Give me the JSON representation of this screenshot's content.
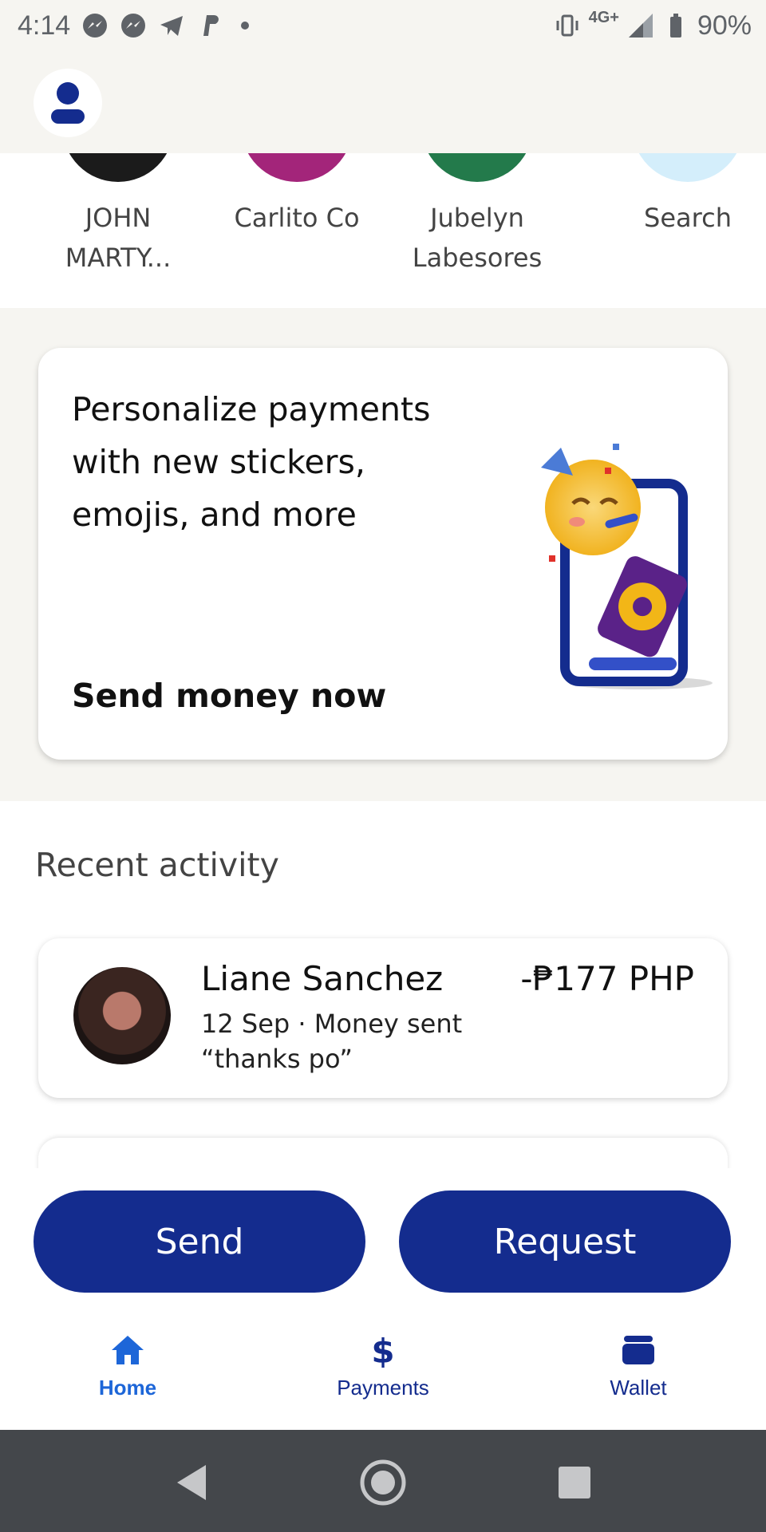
{
  "status_bar": {
    "time": "4:14",
    "network": "4G+",
    "battery": "90%",
    "notification_icons": [
      "messenger-icon",
      "messenger-icon",
      "telegram-icon",
      "paypal-icon"
    ]
  },
  "contacts": [
    {
      "name": "JOHN MARTY...",
      "color": "#1b1b1b"
    },
    {
      "name": "Carlito Co",
      "color": "#a3257a"
    },
    {
      "name": "Jubelyn Labesores",
      "color": "#237a4b"
    },
    {
      "name": "Search",
      "color": "#d4eefb"
    }
  ],
  "promo": {
    "title": "Personalize payments with new stickers, emojis, and more",
    "cta": "Send money now"
  },
  "recent_activity": {
    "heading": "Recent activity",
    "items": [
      {
        "name": "Liane Sanchez",
        "meta": "12 Sep · Money sent",
        "note": "“thanks po”",
        "amount": "-₱177 PHP"
      }
    ]
  },
  "actions": {
    "send_label": "Send",
    "request_label": "Request"
  },
  "nav": {
    "home": "Home",
    "payments": "Payments",
    "wallet": "Wallet"
  },
  "colors": {
    "primary": "#142c8e",
    "active_nav": "#1d66d8",
    "page_bg": "#f6f5f1"
  }
}
